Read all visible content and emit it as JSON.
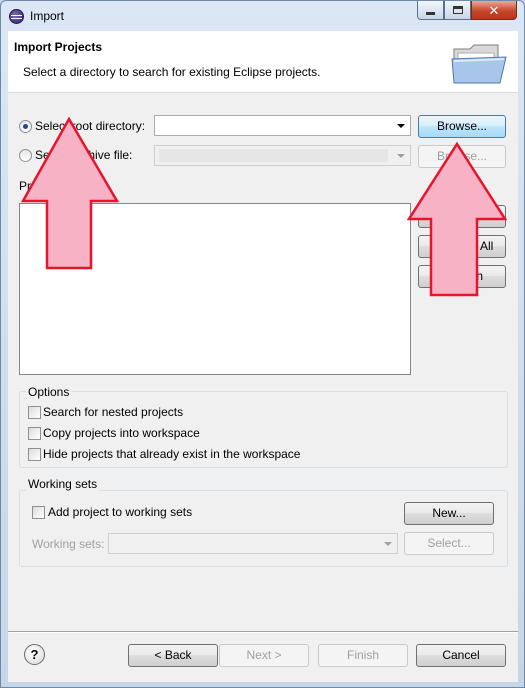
{
  "window": {
    "title": "Import",
    "minimize_glyph": "",
    "close_glyph": "✕"
  },
  "header": {
    "title": "Import Projects",
    "description": "Select a directory to search for existing Eclipse projects."
  },
  "source": {
    "root_dir_label": "Select root directory:",
    "root_dir_value": "",
    "archive_label": "Select archive file:",
    "archive_value": "",
    "browse_label": "Browse...",
    "browse_archive_label": "Browse..."
  },
  "projects": {
    "label": "Projects:",
    "select_all_label": "Select All",
    "deselect_all_label": "Deselect All",
    "refresh_label": "Refresh"
  },
  "options": {
    "title": "Options",
    "items": [
      {
        "label": "Search for nested projects",
        "checked": false
      },
      {
        "label": "Copy projects into workspace",
        "checked": false
      },
      {
        "label": "Hide projects that already exist in the workspace",
        "checked": false
      }
    ]
  },
  "working_sets": {
    "title": "Working sets",
    "add_label": "Add project to working sets",
    "new_label": "New...",
    "sets_label": "Working sets:",
    "select_label": "Select..."
  },
  "footer": {
    "help_glyph": "?",
    "back_label": "< Back",
    "next_label": "Next >",
    "finish_label": "Finish",
    "cancel_label": "Cancel"
  },
  "annotation": {
    "arrow_color": "#f7b2c5",
    "arrow_border": "#e8142c"
  }
}
